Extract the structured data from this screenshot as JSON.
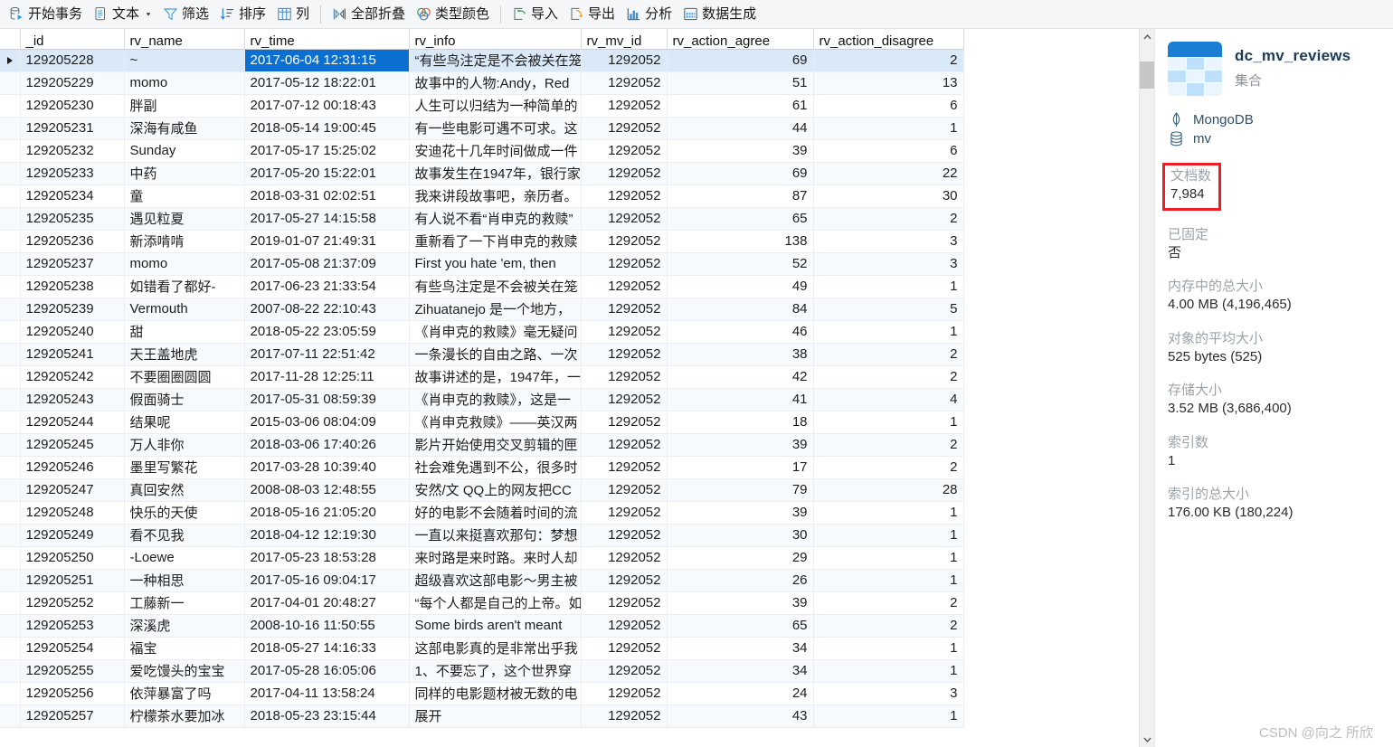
{
  "toolbar": {
    "groups": [
      {
        "items": [
          {
            "icon": "transaction-icon",
            "label": "开始事务",
            "caret": false
          },
          {
            "icon": "text-icon",
            "label": "文本",
            "caret": true
          },
          {
            "icon": "filter-icon",
            "label": "筛选",
            "caret": false
          },
          {
            "icon": "sort-icon",
            "label": "排序",
            "caret": false
          },
          {
            "icon": "columns-icon",
            "label": "列",
            "caret": false
          }
        ]
      },
      {
        "items": [
          {
            "icon": "collapse-all-icon",
            "label": "全部折叠",
            "caret": false
          },
          {
            "icon": "type-color-icon",
            "label": "类型颜色",
            "caret": false
          }
        ]
      },
      {
        "items": [
          {
            "icon": "import-icon",
            "label": "导入",
            "caret": false
          },
          {
            "icon": "export-icon",
            "label": "导出",
            "caret": false
          },
          {
            "icon": "analyze-icon",
            "label": "分析",
            "caret": false
          },
          {
            "icon": "data-generation-icon",
            "label": "数据生成",
            "caret": false
          }
        ]
      }
    ]
  },
  "grid": {
    "columns": [
      "_id",
      "rv_name",
      "rv_time",
      "rv_info",
      "rv_mv_id",
      "rv_action_agree",
      "rv_action_disagree"
    ],
    "selected_row": 0,
    "selected_column": "rv_time",
    "rows": [
      {
        "_id": "129205228",
        "rv_name": "~",
        "rv_time": "2017-06-04 12:31:15",
        "rv_info": "“有些鸟注定是不会被关在笼",
        "rv_mv_id": "1292052",
        "rv_action_agree": "69",
        "rv_action_disagree": "2"
      },
      {
        "_id": "129205229",
        "rv_name": "momo",
        "rv_time": "2017-05-12 18:22:01",
        "rv_info": "故事中的人物:Andy，Red",
        "rv_mv_id": "1292052",
        "rv_action_agree": "51",
        "rv_action_disagree": "13"
      },
      {
        "_id": "129205230",
        "rv_name": "胖副",
        "rv_time": "2017-07-12 00:18:43",
        "rv_info": "人生可以归结为一种简单的",
        "rv_mv_id": "1292052",
        "rv_action_agree": "61",
        "rv_action_disagree": "6"
      },
      {
        "_id": "129205231",
        "rv_name": "深海有咸鱼",
        "rv_time": "2018-05-14 19:00:45",
        "rv_info": "有一些电影可遇不可求。这",
        "rv_mv_id": "1292052",
        "rv_action_agree": "44",
        "rv_action_disagree": "1"
      },
      {
        "_id": "129205232",
        "rv_name": "Sunday",
        "rv_time": "2017-05-17 15:25:02",
        "rv_info": "安迪花十几年时间做成一件",
        "rv_mv_id": "1292052",
        "rv_action_agree": "39",
        "rv_action_disagree": "6"
      },
      {
        "_id": "129205233",
        "rv_name": "中药",
        "rv_time": "2017-05-20 15:22:01",
        "rv_info": "故事发生在1947年，银行家",
        "rv_mv_id": "1292052",
        "rv_action_agree": "69",
        "rv_action_disagree": "22"
      },
      {
        "_id": "129205234",
        "rv_name": "童",
        "rv_time": "2018-03-31 02:02:51",
        "rv_info": "我来讲段故事吧，亲历者。",
        "rv_mv_id": "1292052",
        "rv_action_agree": "87",
        "rv_action_disagree": "30"
      },
      {
        "_id": "129205235",
        "rv_name": "遇见粒夏",
        "rv_time": "2017-05-27 14:15:58",
        "rv_info": "有人说不看“肖申克的救赎”",
        "rv_mv_id": "1292052",
        "rv_action_agree": "65",
        "rv_action_disagree": "2"
      },
      {
        "_id": "129205236",
        "rv_name": "新添啃啃",
        "rv_time": "2019-01-07 21:49:31",
        "rv_info": "重新看了一下肖申克的救赎",
        "rv_mv_id": "1292052",
        "rv_action_agree": "138",
        "rv_action_disagree": "3"
      },
      {
        "_id": "129205237",
        "rv_name": "momo",
        "rv_time": "2017-05-08 21:37:09",
        "rv_info": "First you hate 'em, then",
        "rv_mv_id": "1292052",
        "rv_action_agree": "52",
        "rv_action_disagree": "3"
      },
      {
        "_id": "129205238",
        "rv_name": "如错看了都好-",
        "rv_time": "2017-06-23 21:33:54",
        "rv_info": "有些鸟注定是不会被关在笼",
        "rv_mv_id": "1292052",
        "rv_action_agree": "49",
        "rv_action_disagree": "1"
      },
      {
        "_id": "129205239",
        "rv_name": "Vermouth",
        "rv_time": "2007-08-22 22:10:43",
        "rv_info": "Zihuatanejo 是一个地方，",
        "rv_mv_id": "1292052",
        "rv_action_agree": "84",
        "rv_action_disagree": "5"
      },
      {
        "_id": "129205240",
        "rv_name": "甜",
        "rv_time": "2018-05-22 23:05:59",
        "rv_info": "《肖申克的救赎》毫无疑问",
        "rv_mv_id": "1292052",
        "rv_action_agree": "46",
        "rv_action_disagree": "1"
      },
      {
        "_id": "129205241",
        "rv_name": "天王盖地虎",
        "rv_time": "2017-07-11 22:51:42",
        "rv_info": "一条漫长的自由之路、一次",
        "rv_mv_id": "1292052",
        "rv_action_agree": "38",
        "rv_action_disagree": "2"
      },
      {
        "_id": "129205242",
        "rv_name": "不要圈圈圆圆",
        "rv_time": "2017-11-28 12:25:11",
        "rv_info": "故事讲述的是，1947年，一",
        "rv_mv_id": "1292052",
        "rv_action_agree": "42",
        "rv_action_disagree": "2"
      },
      {
        "_id": "129205243",
        "rv_name": "假面骑士",
        "rv_time": "2017-05-31 08:59:39",
        "rv_info": "《肖申克的救赎》，这是一",
        "rv_mv_id": "1292052",
        "rv_action_agree": "41",
        "rv_action_disagree": "4"
      },
      {
        "_id": "129205244",
        "rv_name": "结果呢",
        "rv_time": "2015-03-06 08:04:09",
        "rv_info": "《肖申克救赎》——英汉两",
        "rv_mv_id": "1292052",
        "rv_action_agree": "18",
        "rv_action_disagree": "1"
      },
      {
        "_id": "129205245",
        "rv_name": "万人非你",
        "rv_time": "2018-03-06 17:40:26",
        "rv_info": "影片开始使用交叉剪辑的匣",
        "rv_mv_id": "1292052",
        "rv_action_agree": "39",
        "rv_action_disagree": "2"
      },
      {
        "_id": "129205246",
        "rv_name": "墨里写繁花",
        "rv_time": "2017-03-28 10:39:40",
        "rv_info": "社会难免遇到不公，很多时",
        "rv_mv_id": "1292052",
        "rv_action_agree": "17",
        "rv_action_disagree": "2"
      },
      {
        "_id": "129205247",
        "rv_name": "真回安然",
        "rv_time": "2008-08-03 12:48:55",
        "rv_info": "安然/文  QQ上的网友把CC",
        "rv_mv_id": "1292052",
        "rv_action_agree": "79",
        "rv_action_disagree": "28"
      },
      {
        "_id": "129205248",
        "rv_name": "快乐的天使",
        "rv_time": "2018-05-16 21:05:20",
        "rv_info": "好的电影不会随着时间的流",
        "rv_mv_id": "1292052",
        "rv_action_agree": "39",
        "rv_action_disagree": "1"
      },
      {
        "_id": "129205249",
        "rv_name": "看不见我",
        "rv_time": "2018-04-12 12:19:30",
        "rv_info": "一直以来挺喜欢那句：梦想",
        "rv_mv_id": "1292052",
        "rv_action_agree": "30",
        "rv_action_disagree": "1"
      },
      {
        "_id": "129205250",
        "rv_name": "-Loewe",
        "rv_time": "2017-05-23 18:53:28",
        "rv_info": "来时路是来时路。来时人却",
        "rv_mv_id": "1292052",
        "rv_action_agree": "29",
        "rv_action_disagree": "1"
      },
      {
        "_id": "129205251",
        "rv_name": "一种相思",
        "rv_time": "2017-05-16 09:04:17",
        "rv_info": "超级喜欢这部电影～男主被",
        "rv_mv_id": "1292052",
        "rv_action_agree": "26",
        "rv_action_disagree": "1"
      },
      {
        "_id": "129205252",
        "rv_name": "工藤新一",
        "rv_time": "2017-04-01 20:48:27",
        "rv_info": "“每个人都是自己的上帝。如",
        "rv_mv_id": "1292052",
        "rv_action_agree": "39",
        "rv_action_disagree": "2"
      },
      {
        "_id": "129205253",
        "rv_name": "深溪虎",
        "rv_time": "2008-10-16 11:50:55",
        "rv_info": "Some birds aren't meant",
        "rv_mv_id": "1292052",
        "rv_action_agree": "65",
        "rv_action_disagree": "2"
      },
      {
        "_id": "129205254",
        "rv_name": "福宝",
        "rv_time": "2018-05-27 14:16:33",
        "rv_info": "这部电影真的是非常出乎我",
        "rv_mv_id": "1292052",
        "rv_action_agree": "34",
        "rv_action_disagree": "1"
      },
      {
        "_id": "129205255",
        "rv_name": "爱吃馒头的宝宝",
        "rv_time": "2017-05-28 16:05:06",
        "rv_info": "1、不要忘了，这个世界穿",
        "rv_mv_id": "1292052",
        "rv_action_agree": "34",
        "rv_action_disagree": "1"
      },
      {
        "_id": "129205256",
        "rv_name": "依萍暴富了吗",
        "rv_time": "2017-04-11 13:58:24",
        "rv_info": "同样的电影题材被无数的电",
        "rv_mv_id": "1292052",
        "rv_action_agree": "24",
        "rv_action_disagree": "3"
      },
      {
        "_id": "129205257",
        "rv_name": "柠檬茶水要加冰",
        "rv_time": "2018-05-23 23:15:44",
        "rv_info": "展开",
        "rv_mv_id": "1292052",
        "rv_action_agree": "43",
        "rv_action_disagree": "1"
      }
    ]
  },
  "info_panel": {
    "title": "dc_mv_reviews",
    "subtitle": "集合",
    "server": "MongoDB",
    "database": "mv",
    "stats": [
      {
        "label": "文档数",
        "value": "7,984",
        "highlighted": true
      },
      {
        "label": "已固定",
        "value": "否",
        "highlighted": false
      },
      {
        "label": "内存中的总大小",
        "value": "4.00 MB (4,196,465)",
        "highlighted": false
      },
      {
        "label": "对象的平均大小",
        "value": "525 bytes (525)",
        "highlighted": false
      },
      {
        "label": "存储大小",
        "value": "3.52 MB (3,686,400)",
        "highlighted": false
      },
      {
        "label": "索引数",
        "value": "1",
        "highlighted": false
      },
      {
        "label": "索引的总大小",
        "value": "176.00 KB (180,224)",
        "highlighted": false
      }
    ]
  },
  "watermark": "CSDN @向之 所欣",
  "colors": {
    "accent": "#0a6fd1",
    "selection_row": "#d9e9f7",
    "highlight_box": "#ee1c24"
  }
}
